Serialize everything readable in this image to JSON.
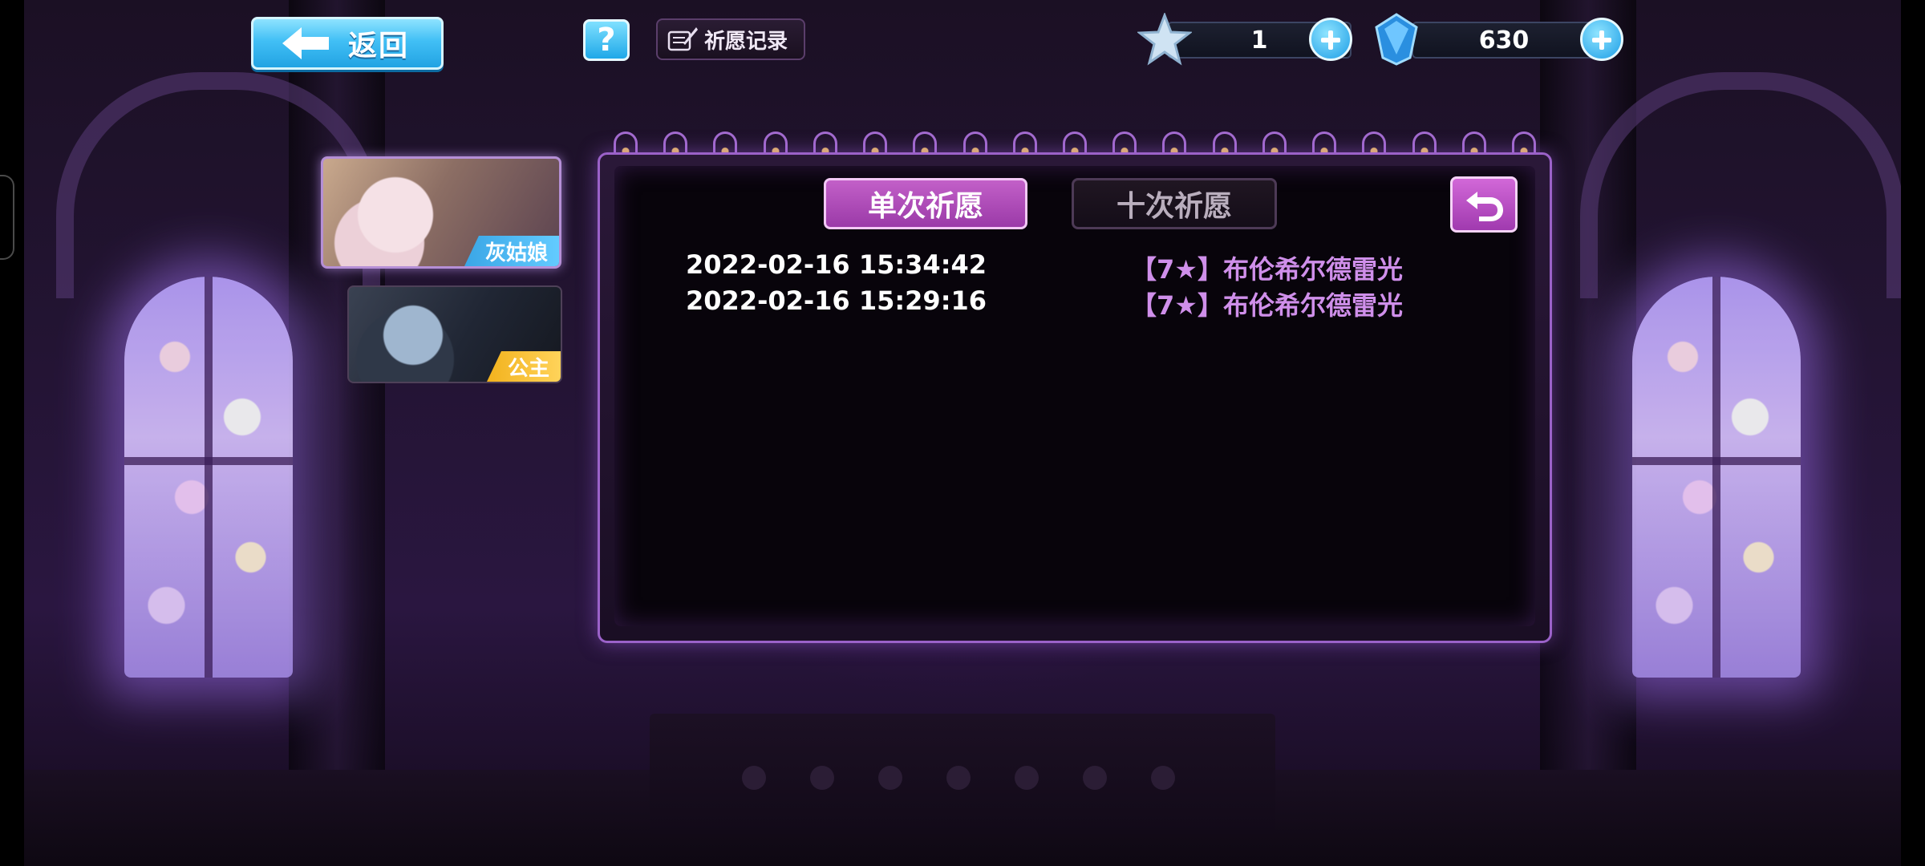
{
  "top_bar": {
    "back_label": "返回",
    "help_label": "?",
    "record_label": "祈愿记录",
    "currencies": [
      {
        "icon": "star-ticket-icon",
        "value": "1"
      },
      {
        "icon": "blue-crystal-icon",
        "value": "630"
      }
    ]
  },
  "characters": [
    {
      "name": "灰姑娘",
      "tag_color": "#3aa6e6"
    },
    {
      "name": "公主",
      "tag_color": "#f2b21d"
    }
  ],
  "tabs": {
    "single": "单次祈愿",
    "ten": "十次祈愿",
    "active": "single"
  },
  "records": [
    {
      "time": "2022-02-16 15:34:42",
      "item": "【7★】布伦希尔德雷光"
    },
    {
      "time": "2022-02-16 15:29:16",
      "item": "【7★】布伦希尔德雷光"
    }
  ],
  "colors": {
    "accent": "#b24fc0",
    "button_blue": "#41bff5",
    "record_item": "#cf8fea"
  }
}
